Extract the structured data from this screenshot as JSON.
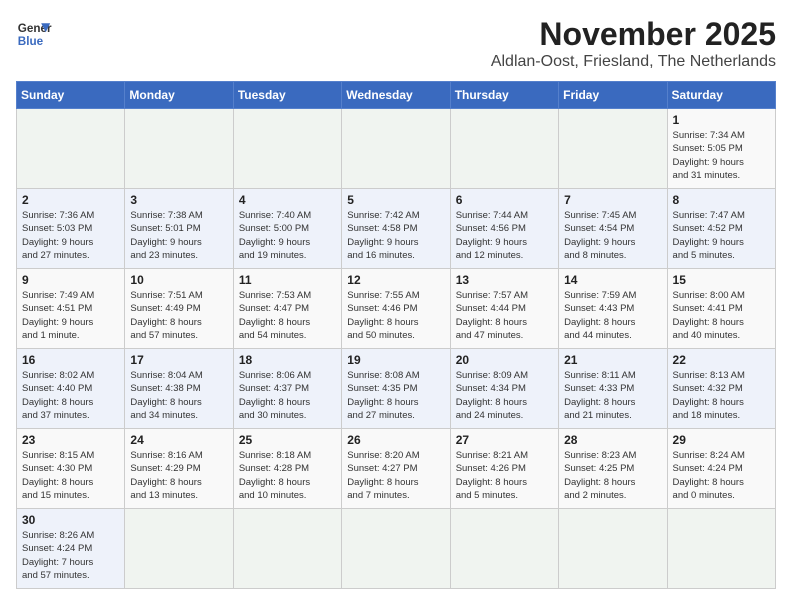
{
  "logo": {
    "line1": "General",
    "line2": "Blue"
  },
  "title": "November 2025",
  "subtitle": "Aldlan-Oost, Friesland, The Netherlands",
  "weekdays": [
    "Sunday",
    "Monday",
    "Tuesday",
    "Wednesday",
    "Thursday",
    "Friday",
    "Saturday"
  ],
  "weeks": [
    [
      {
        "day": "",
        "info": ""
      },
      {
        "day": "",
        "info": ""
      },
      {
        "day": "",
        "info": ""
      },
      {
        "day": "",
        "info": ""
      },
      {
        "day": "",
        "info": ""
      },
      {
        "day": "",
        "info": ""
      },
      {
        "day": "1",
        "info": "Sunrise: 7:34 AM\nSunset: 5:05 PM\nDaylight: 9 hours\nand 31 minutes."
      }
    ],
    [
      {
        "day": "2",
        "info": "Sunrise: 7:36 AM\nSunset: 5:03 PM\nDaylight: 9 hours\nand 27 minutes."
      },
      {
        "day": "3",
        "info": "Sunrise: 7:38 AM\nSunset: 5:01 PM\nDaylight: 9 hours\nand 23 minutes."
      },
      {
        "day": "4",
        "info": "Sunrise: 7:40 AM\nSunset: 5:00 PM\nDaylight: 9 hours\nand 19 minutes."
      },
      {
        "day": "5",
        "info": "Sunrise: 7:42 AM\nSunset: 4:58 PM\nDaylight: 9 hours\nand 16 minutes."
      },
      {
        "day": "6",
        "info": "Sunrise: 7:44 AM\nSunset: 4:56 PM\nDaylight: 9 hours\nand 12 minutes."
      },
      {
        "day": "7",
        "info": "Sunrise: 7:45 AM\nSunset: 4:54 PM\nDaylight: 9 hours\nand 8 minutes."
      },
      {
        "day": "8",
        "info": "Sunrise: 7:47 AM\nSunset: 4:52 PM\nDaylight: 9 hours\nand 5 minutes."
      }
    ],
    [
      {
        "day": "9",
        "info": "Sunrise: 7:49 AM\nSunset: 4:51 PM\nDaylight: 9 hours\nand 1 minute."
      },
      {
        "day": "10",
        "info": "Sunrise: 7:51 AM\nSunset: 4:49 PM\nDaylight: 8 hours\nand 57 minutes."
      },
      {
        "day": "11",
        "info": "Sunrise: 7:53 AM\nSunset: 4:47 PM\nDaylight: 8 hours\nand 54 minutes."
      },
      {
        "day": "12",
        "info": "Sunrise: 7:55 AM\nSunset: 4:46 PM\nDaylight: 8 hours\nand 50 minutes."
      },
      {
        "day": "13",
        "info": "Sunrise: 7:57 AM\nSunset: 4:44 PM\nDaylight: 8 hours\nand 47 minutes."
      },
      {
        "day": "14",
        "info": "Sunrise: 7:59 AM\nSunset: 4:43 PM\nDaylight: 8 hours\nand 44 minutes."
      },
      {
        "day": "15",
        "info": "Sunrise: 8:00 AM\nSunset: 4:41 PM\nDaylight: 8 hours\nand 40 minutes."
      }
    ],
    [
      {
        "day": "16",
        "info": "Sunrise: 8:02 AM\nSunset: 4:40 PM\nDaylight: 8 hours\nand 37 minutes."
      },
      {
        "day": "17",
        "info": "Sunrise: 8:04 AM\nSunset: 4:38 PM\nDaylight: 8 hours\nand 34 minutes."
      },
      {
        "day": "18",
        "info": "Sunrise: 8:06 AM\nSunset: 4:37 PM\nDaylight: 8 hours\nand 30 minutes."
      },
      {
        "day": "19",
        "info": "Sunrise: 8:08 AM\nSunset: 4:35 PM\nDaylight: 8 hours\nand 27 minutes."
      },
      {
        "day": "20",
        "info": "Sunrise: 8:09 AM\nSunset: 4:34 PM\nDaylight: 8 hours\nand 24 minutes."
      },
      {
        "day": "21",
        "info": "Sunrise: 8:11 AM\nSunset: 4:33 PM\nDaylight: 8 hours\nand 21 minutes."
      },
      {
        "day": "22",
        "info": "Sunrise: 8:13 AM\nSunset: 4:32 PM\nDaylight: 8 hours\nand 18 minutes."
      }
    ],
    [
      {
        "day": "23",
        "info": "Sunrise: 8:15 AM\nSunset: 4:30 PM\nDaylight: 8 hours\nand 15 minutes."
      },
      {
        "day": "24",
        "info": "Sunrise: 8:16 AM\nSunset: 4:29 PM\nDaylight: 8 hours\nand 13 minutes."
      },
      {
        "day": "25",
        "info": "Sunrise: 8:18 AM\nSunset: 4:28 PM\nDaylight: 8 hours\nand 10 minutes."
      },
      {
        "day": "26",
        "info": "Sunrise: 8:20 AM\nSunset: 4:27 PM\nDaylight: 8 hours\nand 7 minutes."
      },
      {
        "day": "27",
        "info": "Sunrise: 8:21 AM\nSunset: 4:26 PM\nDaylight: 8 hours\nand 5 minutes."
      },
      {
        "day": "28",
        "info": "Sunrise: 8:23 AM\nSunset: 4:25 PM\nDaylight: 8 hours\nand 2 minutes."
      },
      {
        "day": "29",
        "info": "Sunrise: 8:24 AM\nSunset: 4:24 PM\nDaylight: 8 hours\nand 0 minutes."
      }
    ],
    [
      {
        "day": "30",
        "info": "Sunrise: 8:26 AM\nSunset: 4:24 PM\nDaylight: 7 hours\nand 57 minutes."
      },
      {
        "day": "",
        "info": ""
      },
      {
        "day": "",
        "info": ""
      },
      {
        "day": "",
        "info": ""
      },
      {
        "day": "",
        "info": ""
      },
      {
        "day": "",
        "info": ""
      },
      {
        "day": "",
        "info": ""
      }
    ]
  ]
}
